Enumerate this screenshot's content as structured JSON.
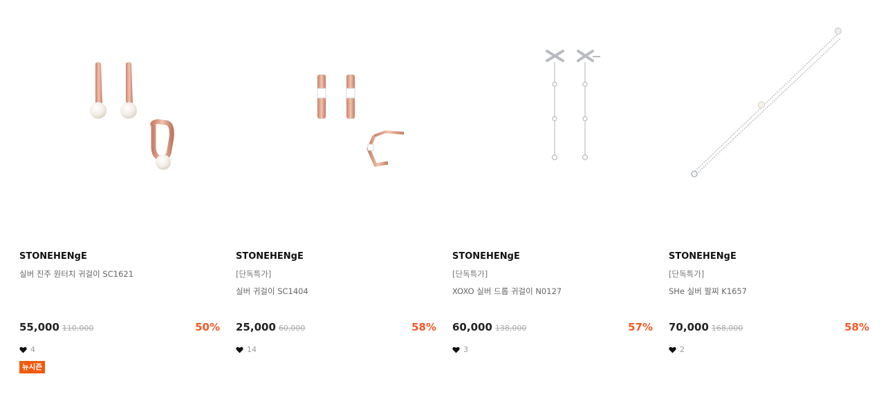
{
  "products": [
    {
      "brand": "STONEHENgE",
      "tag": "",
      "name": "실버 진주 원터치 귀걸이 SC1621",
      "price": "55,000",
      "original_price": "110,000",
      "discount": "50%",
      "likes": "4",
      "badge": "뉴시즌",
      "image": "rose-gold-pearl-hoop-earrings"
    },
    {
      "brand": "STONEHENgE",
      "tag": "[단독특가]",
      "name": "실버 귀걸이 SC1404",
      "price": "25,000",
      "original_price": "60,000",
      "discount": "58%",
      "likes": "14",
      "image": "rose-gold-hexagon-earrings"
    },
    {
      "brand": "STONEHENgE",
      "tag": "[단독특가]",
      "name": "XOXO 실버 드롭 귀걸이 N0127",
      "price": "60,000",
      "original_price": "138,000",
      "discount": "57%",
      "likes": "3",
      "image": "silver-x-drop-earrings"
    },
    {
      "brand": "STONEHENgE",
      "tag": "[단독특가]",
      "name": "SHe 실버 팔찌 K1657",
      "price": "70,000",
      "original_price": "168,000",
      "discount": "58%",
      "likes": "2",
      "image": "silver-chain-bracelet"
    }
  ],
  "colors": {
    "discount": "#f15a29",
    "badge": "#f15a0e",
    "rose_gold": "#e3a48d",
    "silver": "#c8cbcf"
  },
  "icons": {
    "like": "heart-icon"
  }
}
